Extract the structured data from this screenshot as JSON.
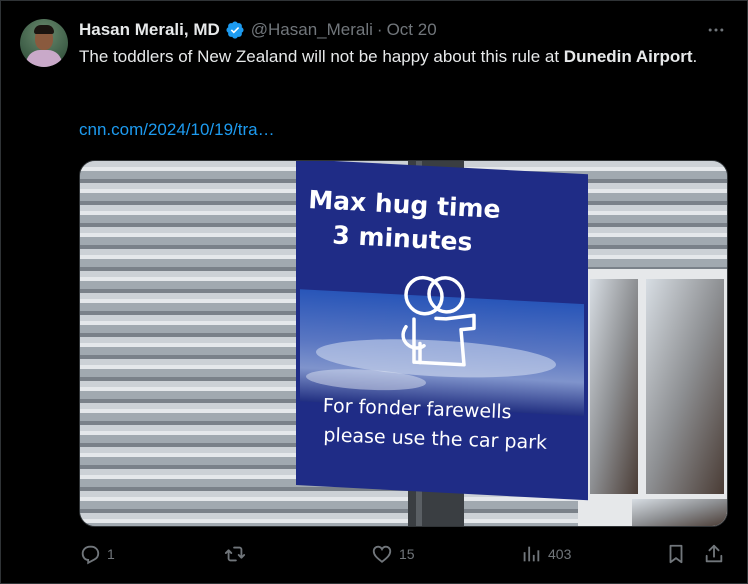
{
  "tweet": {
    "author_name": "Hasan Merali, MD",
    "handle": "@Hasan_Merali",
    "separator": "·",
    "date": "Oct 20",
    "text_before": "The toddlers of New Zealand will not be happy about this rule at ",
    "text_bold": "Dunedin Airport",
    "text_after": ".",
    "link": "cnn.com/2024/10/19/tra…",
    "sign": {
      "title_line1": "Max hug time",
      "title_line2": "3 minutes",
      "subtitle_line1": "For fonder farewells",
      "subtitle_line2": "please use the car park"
    }
  },
  "actions": {
    "replies": "1",
    "retweets": "",
    "likes": "15",
    "views": "403"
  },
  "colors": {
    "accent": "#1d9bf0",
    "muted": "#71767b",
    "sign_blue": "#212e8a"
  },
  "icons": [
    "more-icon",
    "verified-icon",
    "reply-icon",
    "retweet-icon",
    "like-icon",
    "views-icon",
    "bookmark-icon",
    "share-icon"
  ]
}
